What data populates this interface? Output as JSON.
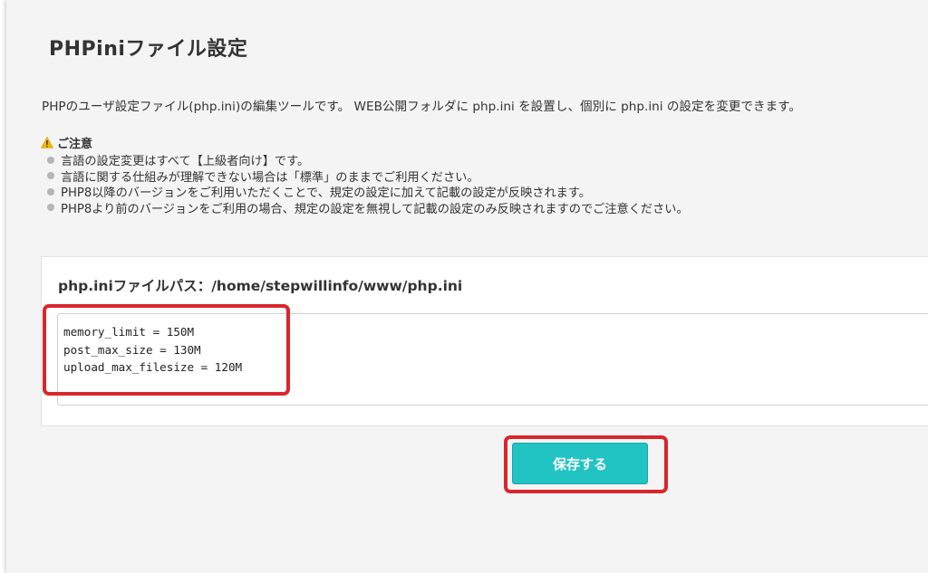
{
  "page": {
    "title": "PHPiniファイル設定",
    "description": "PHPのユーザ設定ファイル(php.ini)の編集ツールです。 WEB公開フォルダに php.ini を設置し、個別に php.ini の設定を変更できます。"
  },
  "notice": {
    "heading": "ご注意",
    "icon": "warning-icon",
    "items": [
      "言語の設定変更はすべて【上級者向け】です。",
      "言語に関する仕組みが理解できない場合は「標準」のままでご利用ください。",
      "PHP8以降のバージョンをご利用いただくことで、規定の設定に加えて記載の設定が反映されます。",
      "PHP8より前のバージョンをご利用の場合、規定の設定を無視して記載の設定のみ反映されますのでご注意ください。"
    ]
  },
  "editor": {
    "path_label": "php.iniファイルパス：/home/stepwillinfo/www/php.ini",
    "content": "memory_limit = 150M\npost_max_size = 130M\nupload_max_filesize = 120M"
  },
  "actions": {
    "save_label": "保存する"
  },
  "colors": {
    "accent": "#21c3c3",
    "highlight": "#d9262b",
    "warning": "#f5b800"
  }
}
